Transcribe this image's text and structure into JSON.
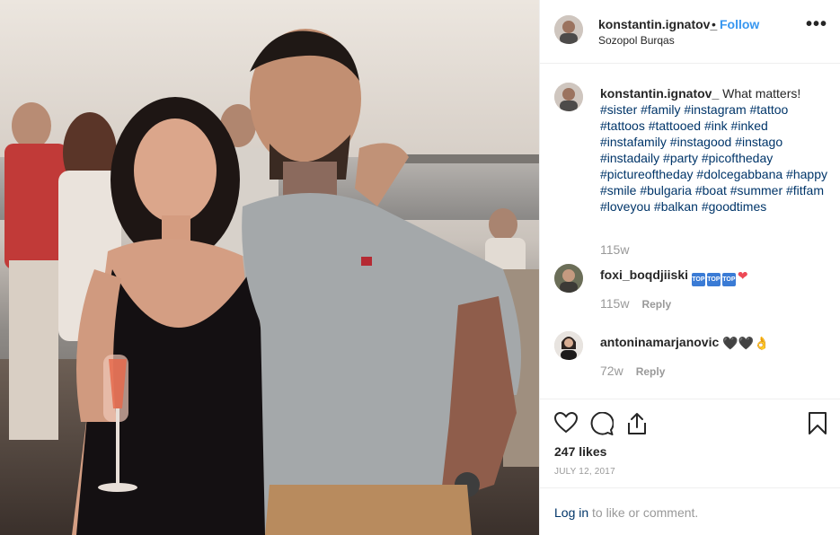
{
  "post": {
    "author": "konstantin.ignatov_",
    "follow_label": "Follow",
    "separator": "•",
    "location": "Sozopol Burqas",
    "more_label": "•••"
  },
  "caption": {
    "author": "konstantin.ignatov_",
    "text": "What matters!",
    "hashtags": "#sister #family #instagram #tattoo #tattoos #tattooed #ink #inked #instafamily #instagood #instago #instadaily #party #picoftheday #pictureoftheday #dolcegabbana #happy #smile #bulgaria #boat #summer #fitfam #loveyou #balkan #goodtimes",
    "age": "115w"
  },
  "comments": [
    {
      "author": "foxi_boqdjiiski",
      "badge_text": "TOP",
      "emoji": "❤",
      "age": "115w",
      "reply_label": "Reply"
    },
    {
      "author": "antoninamarjanovic",
      "emoji": "🖤🖤👌",
      "age": "72w",
      "reply_label": "Reply"
    }
  ],
  "stats": {
    "likes": "247 likes",
    "date": "JULY 12, 2017"
  },
  "login": {
    "link": "Log in",
    "rest": " to like or comment."
  },
  "colors": {
    "link_blue": "#3897f0",
    "hashtag_blue": "#003569",
    "heart_red": "#ed4956",
    "muted_gray": "#999999"
  },
  "icons": [
    "heart-icon",
    "comment-icon",
    "share-icon",
    "bookmark-icon",
    "more-options-icon"
  ]
}
